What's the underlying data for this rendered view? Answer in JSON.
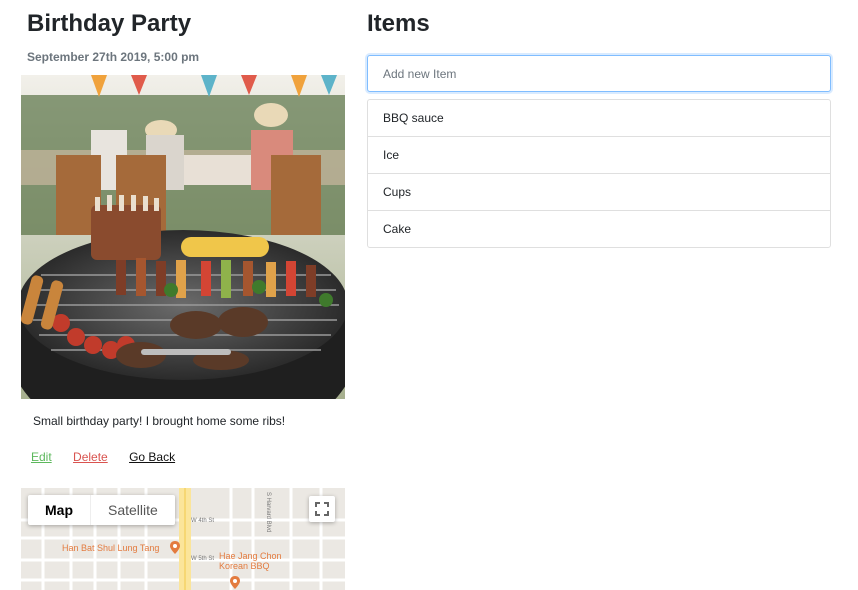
{
  "event": {
    "title": "Birthday Party",
    "date": "September 27th 2019, 5:00 pm",
    "description": "Small birthday party! I brought home some ribs!"
  },
  "actions": {
    "edit": "Edit",
    "delete": "Delete",
    "back": "Go Back"
  },
  "map": {
    "map_label": "Map",
    "satellite_label": "Satellite",
    "place1": "Han Bat Shul Lung Tang",
    "place2_line1": "Hae Jang Chon",
    "place2_line2": "Korean BBQ",
    "street1": "W 4th St",
    "street2": "W 5th St",
    "street3": "S Harvard Blvd",
    "place_color": "#e37b3f"
  },
  "items": {
    "title": "Items",
    "placeholder": "Add new Item",
    "list": [
      {
        "label": "BBQ sauce"
      },
      {
        "label": "Ice"
      },
      {
        "label": "Cups"
      },
      {
        "label": "Cake"
      }
    ]
  }
}
